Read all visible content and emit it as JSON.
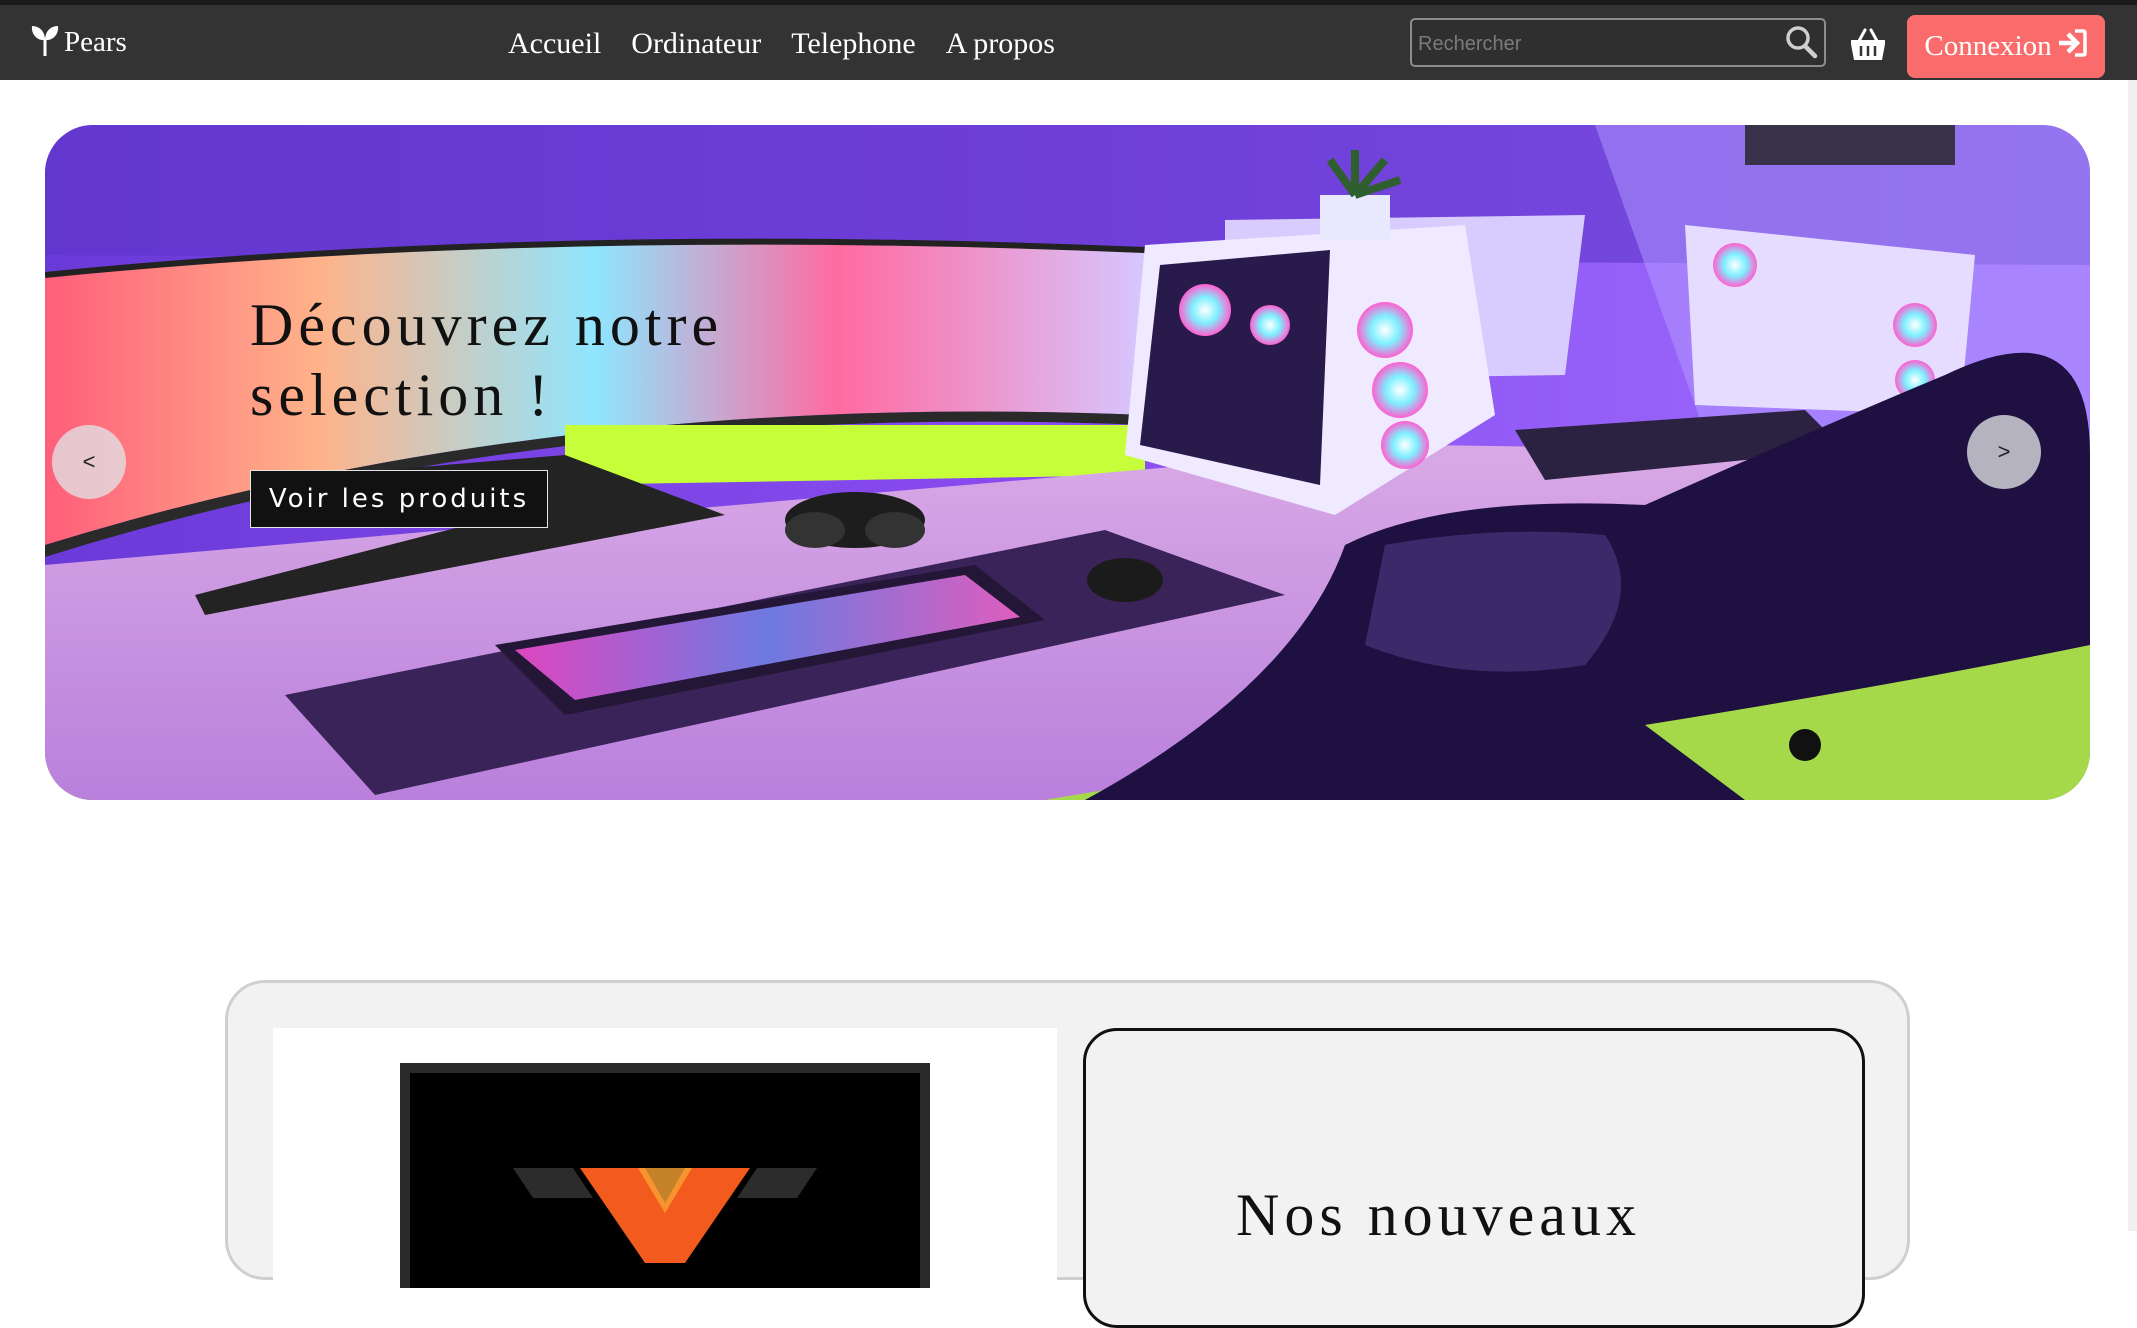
{
  "navbar": {
    "brand": "Pears",
    "links": [
      "Accueil",
      "Ordinateur",
      "Telephone",
      "A propos"
    ],
    "search_placeholder": "Rechercher",
    "login_label": "Connexion",
    "colors": {
      "bar": "#333333",
      "login": "#fa6c6c"
    },
    "icons": [
      "leaf-logo-icon",
      "search-icon",
      "basket-icon",
      "login-arrow-icon"
    ]
  },
  "hero": {
    "title": "Découvrez notre selection !",
    "cta_label": "Voir les produits",
    "prev_label": "<",
    "next_label": ">"
  },
  "new_section": {
    "title": "Nos nouveaux"
  }
}
